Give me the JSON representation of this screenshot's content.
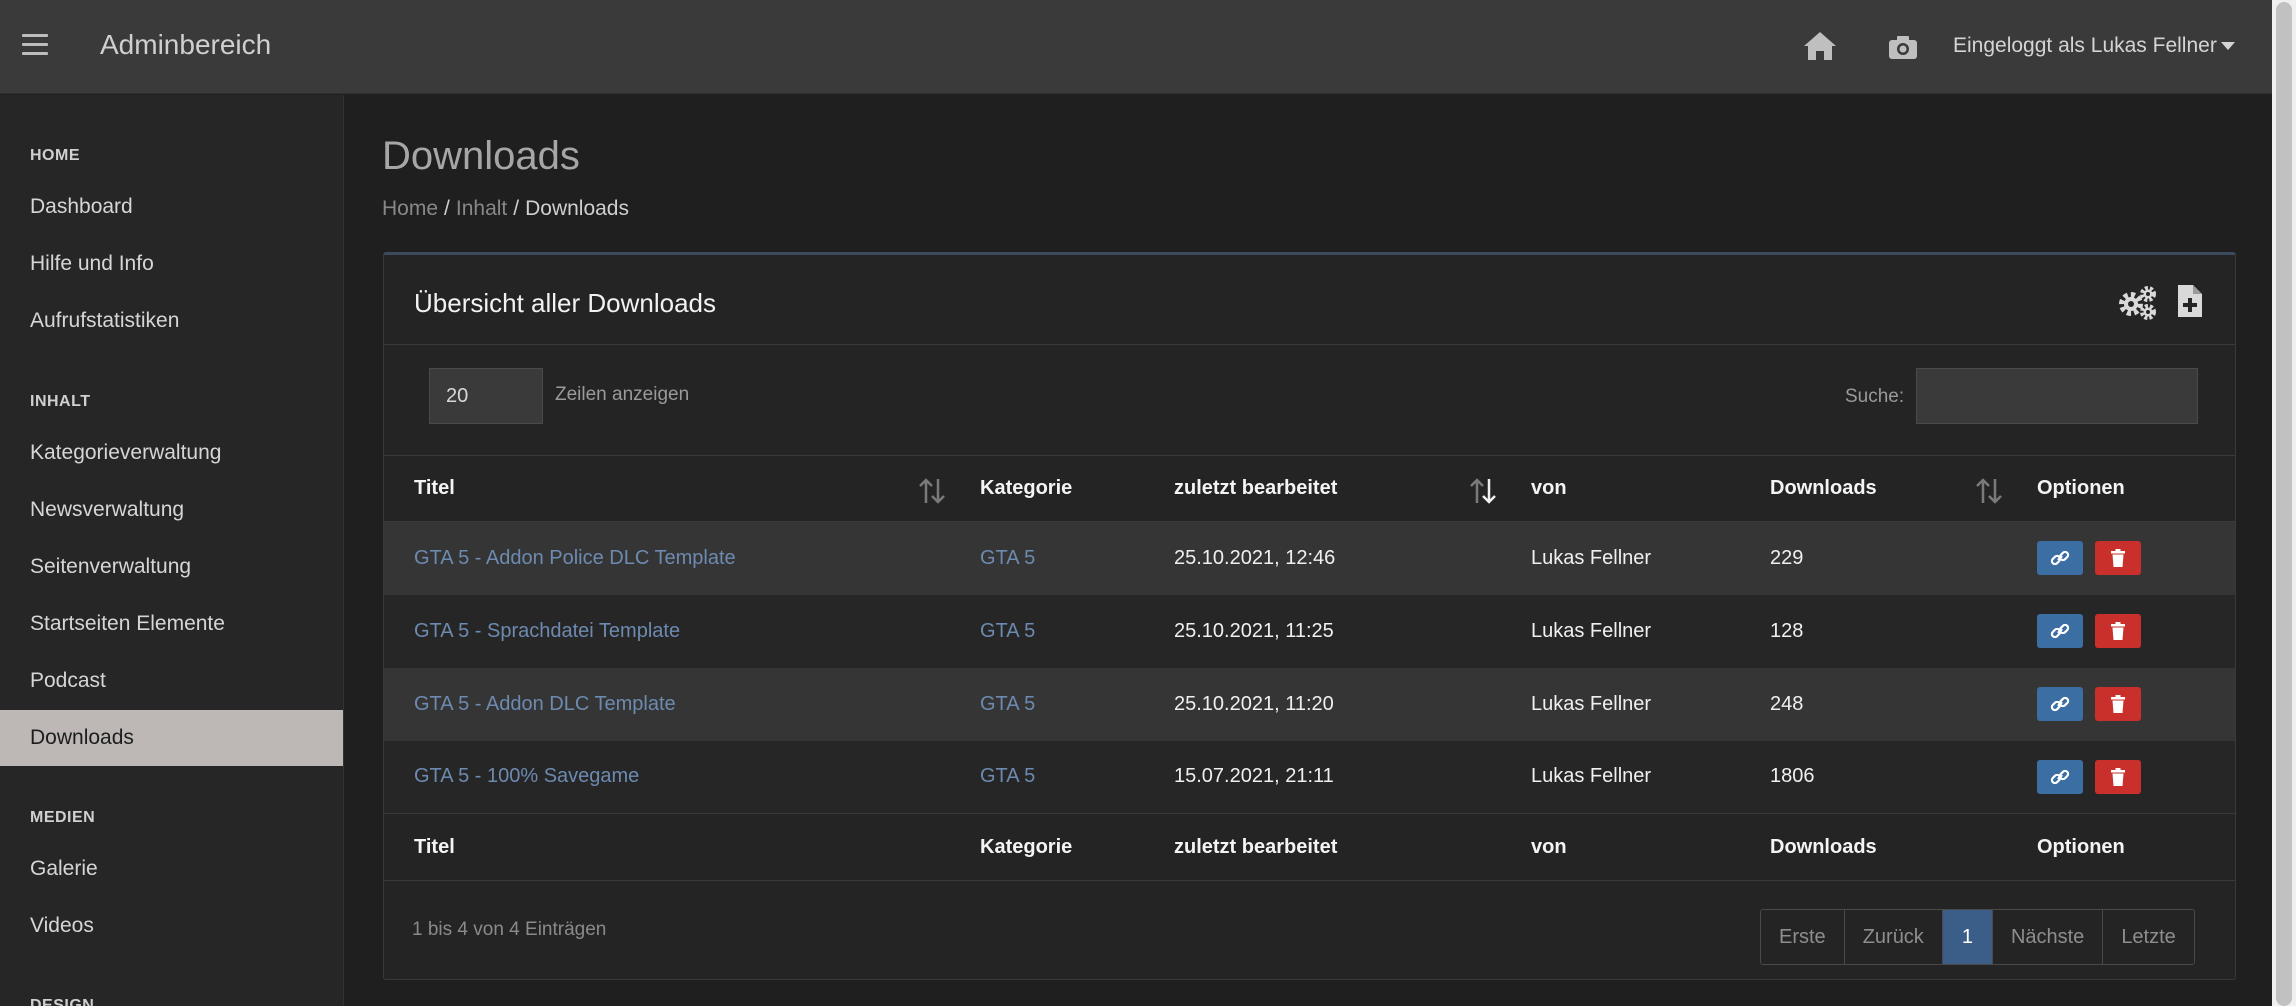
{
  "header": {
    "app_title": "Adminbereich",
    "user_label": "Eingeloggt als Lukas Fellner",
    "icons": [
      "menu-icon",
      "home-icon",
      "camera-icon"
    ]
  },
  "sidebar": {
    "sections": [
      {
        "title": "HOME",
        "items": [
          {
            "label": "Dashboard"
          },
          {
            "label": "Hilfe und Info"
          },
          {
            "label": "Aufrufstatistiken"
          }
        ]
      },
      {
        "title": "INHALT",
        "items": [
          {
            "label": "Kategorieverwaltung"
          },
          {
            "label": "Newsverwaltung"
          },
          {
            "label": "Seitenverwaltung"
          },
          {
            "label": "Startseiten Elemente"
          },
          {
            "label": "Podcast"
          },
          {
            "label": "Downloads",
            "active": true
          }
        ]
      },
      {
        "title": "MEDIEN",
        "items": [
          {
            "label": "Galerie"
          },
          {
            "label": "Videos"
          }
        ]
      },
      {
        "title": "DESIGN",
        "items": []
      }
    ]
  },
  "page": {
    "title": "Downloads",
    "breadcrumb": [
      "Home",
      "Inhalt",
      "Downloads"
    ]
  },
  "card": {
    "title": "Übersicht aller Downloads",
    "icons": [
      "gears-icon",
      "file-plus-icon"
    ],
    "length_value": "20",
    "length_label": "Zeilen anzeigen",
    "search_label": "Suche:",
    "search_value": ""
  },
  "table": {
    "columns": [
      "Titel",
      "Kategorie",
      "zuletzt bearbeitet",
      "von",
      "Downloads",
      "Optionen"
    ],
    "rows": [
      {
        "title": "GTA 5 - Addon Police DLC Template",
        "category": "GTA 5",
        "edited": "25.10.2021, 12:46",
        "by": "Lukas Fellner",
        "downloads": "229"
      },
      {
        "title": "GTA 5 - Sprachdatei Template",
        "category": "GTA 5",
        "edited": "25.10.2021, 11:25",
        "by": "Lukas Fellner",
        "downloads": "128"
      },
      {
        "title": "GTA 5 - Addon DLC Template",
        "category": "GTA 5",
        "edited": "25.10.2021, 11:20",
        "by": "Lukas Fellner",
        "downloads": "248"
      },
      {
        "title": "GTA 5 - 100% Savegame",
        "category": "GTA 5",
        "edited": "15.07.2021, 21:11",
        "by": "Lukas Fellner",
        "downloads": "1806"
      }
    ],
    "row_action_icons": [
      "link-icon",
      "trash-icon"
    ]
  },
  "footer": {
    "info": "1 bis 4 von 4 Einträgen",
    "pagination": [
      "Erste",
      "Zurück",
      "1",
      "Nächste",
      "Letzte"
    ],
    "active_page": "1"
  },
  "colors": {
    "link": "#6d8ab0",
    "primary_button": "#3b6ea3",
    "danger_button": "#c9302c",
    "active_sidebar": "#bdb8b6"
  }
}
